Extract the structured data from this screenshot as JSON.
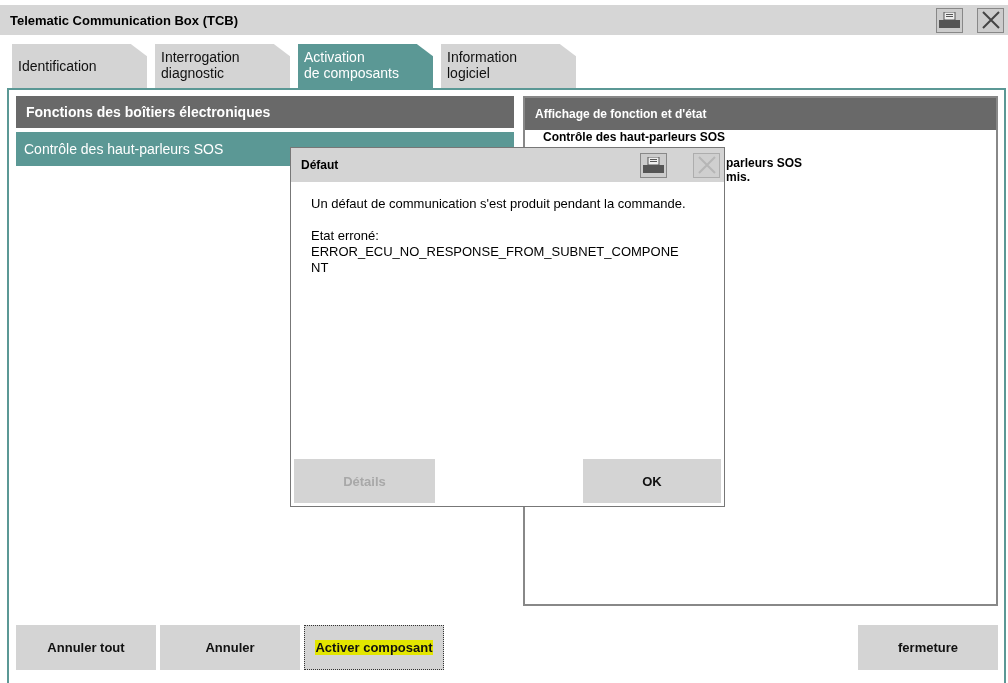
{
  "window": {
    "title": "Telematic Communication Box (TCB)"
  },
  "tabs": [
    {
      "label": "Identification",
      "selected": false
    },
    {
      "label": "Interrogation\ndiagnostic",
      "selected": false
    },
    {
      "label": "Activation\nde composants",
      "selected": true
    },
    {
      "label": "Information\nlogiciel",
      "selected": false
    }
  ],
  "functions_panel": {
    "title": "Fonctions des boîtiers électroniques",
    "items": [
      {
        "label": "Contrôle des haut-parleurs SOS",
        "selected": true
      }
    ]
  },
  "status_panel": {
    "title": "Affichage de fonction et d'état",
    "lines": [
      "Contrôle des haut-parleurs SOS",
      "parleurs SOS",
      "mis."
    ]
  },
  "dialog": {
    "title": "Défaut",
    "message": "Un défaut de communication s'est produit pendant la commande.",
    "error_label": "Etat erroné:",
    "error_code": "ERROR_ECU_NO_RESPONSE_FROM_SUBNET_COMPONE\nNT",
    "close_disabled": true,
    "buttons": [
      {
        "label": "Détails",
        "disabled": true
      },
      {
        "label": "OK",
        "disabled": false
      }
    ]
  },
  "buttons": [
    {
      "label": "Annuler tout",
      "focused": false,
      "highlighted": false
    },
    {
      "label": "Annuler",
      "focused": false,
      "highlighted": false
    },
    {
      "label": "Activer composant",
      "focused": true,
      "highlighted": true
    }
  ],
  "close_button": {
    "label": "fermeture"
  }
}
